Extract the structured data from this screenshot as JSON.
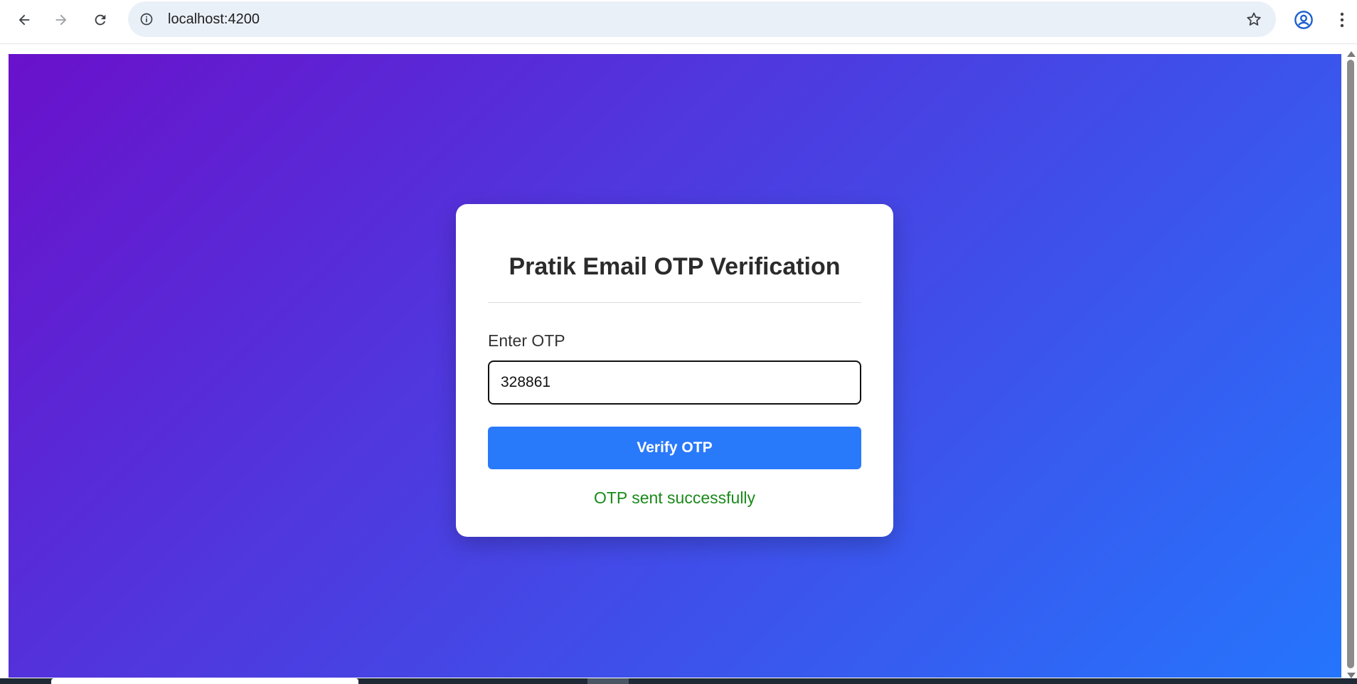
{
  "browser": {
    "url": "localhost:4200",
    "icons": {
      "back": "arrow-left-icon",
      "forward": "arrow-right-icon",
      "reload": "reload-icon",
      "site_info": "info-icon",
      "bookmark": "star-icon",
      "profile": "account-circle-icon",
      "menu": "more-vert-icon"
    }
  },
  "card": {
    "title": "Pratik Email OTP Verification",
    "otp_label": "Enter OTP",
    "otp_value": "328861",
    "verify_button_label": "Verify OTP",
    "status_message": "OTP sent successfully"
  },
  "colors": {
    "gradient_start": "#6a11cb",
    "gradient_end": "#2575fc",
    "button": "#2979fb",
    "success": "#1a8a1a"
  }
}
